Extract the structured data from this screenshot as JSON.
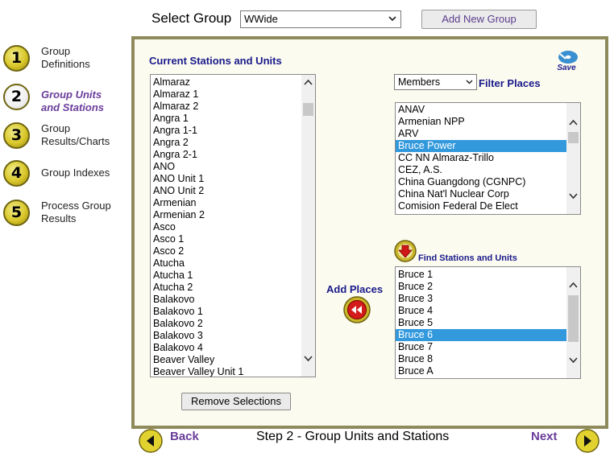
{
  "header": {
    "select_group_label": "Select Group",
    "group_value": "WWide",
    "add_group_label": "Add New Group"
  },
  "nav": {
    "items": [
      {
        "number": "1",
        "line1": "Group",
        "line2": "Definitions",
        "active": false
      },
      {
        "number": "2",
        "line1": "Group Units",
        "line2": "and Stations",
        "active": true
      },
      {
        "number": "3",
        "line1": "Group",
        "line2": "Results/Charts",
        "active": false
      },
      {
        "number": "4",
        "line1": "Group Indexes",
        "line2": "",
        "active": false
      },
      {
        "number": "5",
        "line1": "Process Group",
        "line2": "Results",
        "active": false
      }
    ]
  },
  "current": {
    "title": "Current Stations and Units",
    "items": [
      "Almaraz",
      "Almaraz 1",
      "Almaraz 2",
      "Angra 1",
      "Angra 1-1",
      "Angra 2",
      "Angra 2-1",
      "ANO",
      "ANO Unit 1",
      "ANO Unit 2",
      "Armenian",
      "Armenian 2",
      "Asco",
      "Asco 1",
      "Asco 2",
      "Atucha",
      "Atucha 1",
      "Atucha 2",
      "Balakovo",
      "Balakovo 1",
      "Balakovo 2",
      "Balakovo 3",
      "Balakovo 4",
      "Beaver Valley",
      "Beaver Valley Unit 1"
    ],
    "remove_label": "Remove Selections"
  },
  "save": {
    "label": "Save"
  },
  "filter": {
    "members_value": "Members",
    "label": "Filter Places",
    "items": [
      "ANAV",
      "Armenian NPP",
      "ARV",
      "Bruce Power",
      "CC NN Almaraz-Trillo",
      "CEZ, A.S.",
      "China Guangdong (CGNPC)",
      "China Nat'l Nuclear Corp",
      "Comision Federal De Elect"
    ],
    "selected_index": 3
  },
  "find": {
    "label": "Find Stations and Units",
    "items": [
      "Bruce 1",
      "Bruce 2",
      "Bruce 3",
      "Bruce 4",
      "Bruce 5",
      "Bruce 6",
      "Bruce 7",
      "Bruce 8",
      "Bruce A"
    ],
    "selected_index": 5
  },
  "add_places": {
    "label": "Add Places"
  },
  "footer": {
    "back_label": "Back",
    "step_label": "Step 2 - Group Units and Stations",
    "next_label": "Next"
  },
  "colors": {
    "accent_purple": "#6a3d9a",
    "title_navy": "#1a1a8c",
    "selection_blue": "#3399dd",
    "panel_border": "#8f8a5c",
    "nav_gold": "#d9c72a"
  },
  "icons": {
    "group_select": "chevron-down-icon",
    "save": "save-disk-icon",
    "find": "red-down-arrow-icon",
    "add_places": "red-rewind-icon",
    "back": "left-arrow-icon",
    "next": "right-arrow-icon"
  }
}
